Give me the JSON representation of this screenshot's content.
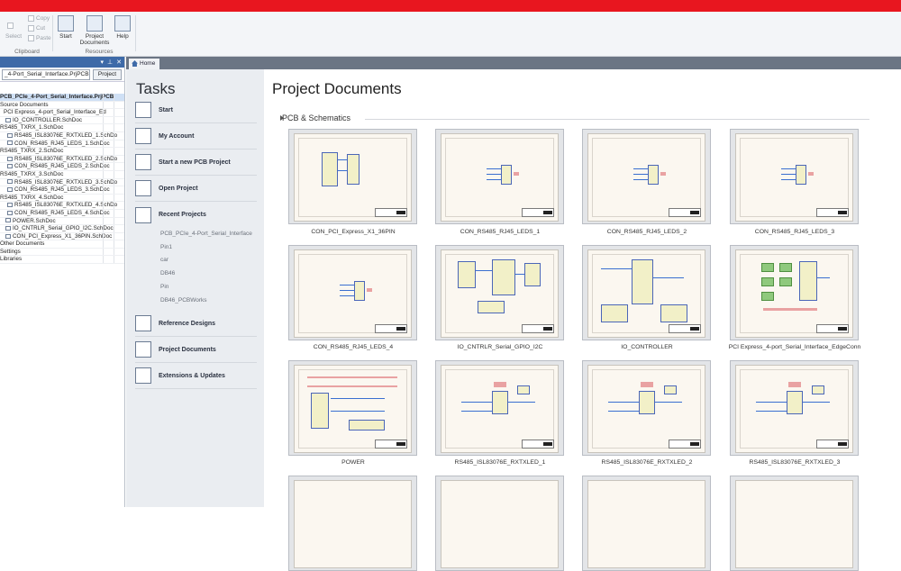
{
  "ribbon": {
    "clipboard": {
      "select": "Select",
      "copy": "Copy",
      "cut": "Cut",
      "paste": "Paste",
      "group_label": "Clipboard"
    },
    "resources": {
      "start": "Start",
      "project_documents": "Project Documents",
      "help": "Help",
      "group_label": "Resources"
    }
  },
  "left_pane": {
    "project_box": "_4-Port_Serial_Interface.PrjPCB",
    "project_button": "Project",
    "tree": [
      "PCB_PCIe_4-Port_Serial_Interface.PrjPCB",
      "Source Documents",
      "PCI Express_4-port_Serial_Interface_Ed",
      "IO_CONTROLLER.SchDoc",
      "RS485_TXRX_1.SchDoc",
      "RS485_ISL83076E_RXTXLED_1.SchDo",
      "CON_RS485_RJ45_LEDS_1.SchDoc",
      "RS485_TXRX_2.SchDoc",
      "RS485_ISL83076E_RXTXLED_2.SchDo",
      "CON_RS485_RJ45_LEDS_2.SchDoc",
      "RS485_TXRX_3.SchDoc",
      "RS485_ISL83076E_RXTXLED_3.SchDo",
      "CON_RS485_RJ45_LEDS_3.SchDoc",
      "RS485_TXRX_4.SchDoc",
      "RS485_ISL83076E_RXTXLED_4.SchDo",
      "CON_RS485_RJ45_LEDS_4.SchDoc",
      "POWER.SchDoc",
      "IO_CNTRLR_Serial_GPIO_I2C.SchDoc",
      "CON_PCI_Express_X1_36PIN.SchDoc",
      "Other Documents",
      "Settings",
      "Libraries"
    ]
  },
  "tab": {
    "home": "Home"
  },
  "tasks": {
    "title": "Tasks",
    "items": [
      "Start",
      "My Account",
      "Start a new PCB Project",
      "Open Project",
      "Recent Projects"
    ],
    "recent": [
      "PCB_PCIe_4-Port_Serial_Interface",
      "Pin1",
      "car",
      "DB46",
      "Pin",
      "DB46_PCBWorks"
    ],
    "bottom_items": [
      "Reference Designs",
      "Project Documents",
      "Extensions & Updates"
    ]
  },
  "main": {
    "title": "Project Documents",
    "section": "PCB & Schematics",
    "documents": [
      "CON_PCI_Express_X1_36PIN",
      "CON_RS485_RJ45_LEDS_1",
      "CON_RS485_RJ45_LEDS_2",
      "CON_RS485_RJ45_LEDS_3",
      "CON_RS485_RJ45_LEDS_4",
      "IO_CNTRLR_Serial_GPIO_I2C",
      "IO_CONTROLLER",
      "PCI Express_4-port_Serial_Interface_EdgeConn",
      "POWER",
      "RS485_ISL83076E_RXTXLED_1",
      "RS485_ISL83076E_RXTXLED_2",
      "RS485_ISL83076E_RXTXLED_3"
    ]
  },
  "colors": {
    "brand_bar": "#e8161f",
    "pane_header": "#3e6aa8",
    "tab_strip": "#6b7584"
  }
}
